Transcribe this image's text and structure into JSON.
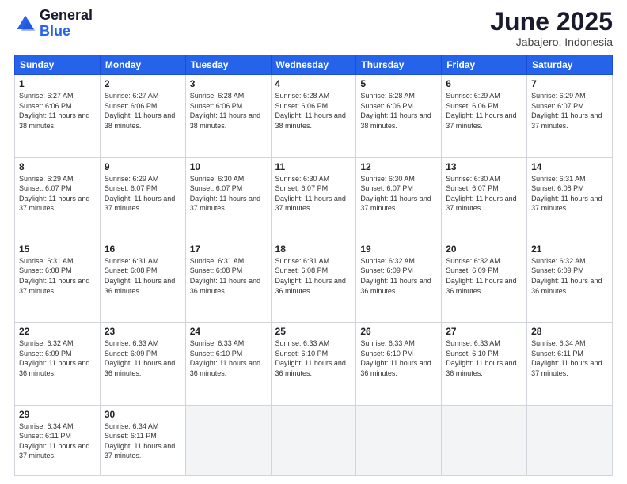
{
  "logo": {
    "general": "General",
    "blue": "Blue"
  },
  "title": "June 2025",
  "location": "Jabajero, Indonesia",
  "weekdays": [
    "Sunday",
    "Monday",
    "Tuesday",
    "Wednesday",
    "Thursday",
    "Friday",
    "Saturday"
  ],
  "weeks": [
    [
      {
        "day": 1,
        "sunrise": "6:27 AM",
        "sunset": "6:06 PM",
        "daylight": "11 hours and 38 minutes."
      },
      {
        "day": 2,
        "sunrise": "6:27 AM",
        "sunset": "6:06 PM",
        "daylight": "11 hours and 38 minutes."
      },
      {
        "day": 3,
        "sunrise": "6:28 AM",
        "sunset": "6:06 PM",
        "daylight": "11 hours and 38 minutes."
      },
      {
        "day": 4,
        "sunrise": "6:28 AM",
        "sunset": "6:06 PM",
        "daylight": "11 hours and 38 minutes."
      },
      {
        "day": 5,
        "sunrise": "6:28 AM",
        "sunset": "6:06 PM",
        "daylight": "11 hours and 38 minutes."
      },
      {
        "day": 6,
        "sunrise": "6:29 AM",
        "sunset": "6:06 PM",
        "daylight": "11 hours and 37 minutes."
      },
      {
        "day": 7,
        "sunrise": "6:29 AM",
        "sunset": "6:07 PM",
        "daylight": "11 hours and 37 minutes."
      }
    ],
    [
      {
        "day": 8,
        "sunrise": "6:29 AM",
        "sunset": "6:07 PM",
        "daylight": "11 hours and 37 minutes."
      },
      {
        "day": 9,
        "sunrise": "6:29 AM",
        "sunset": "6:07 PM",
        "daylight": "11 hours and 37 minutes."
      },
      {
        "day": 10,
        "sunrise": "6:30 AM",
        "sunset": "6:07 PM",
        "daylight": "11 hours and 37 minutes."
      },
      {
        "day": 11,
        "sunrise": "6:30 AM",
        "sunset": "6:07 PM",
        "daylight": "11 hours and 37 minutes."
      },
      {
        "day": 12,
        "sunrise": "6:30 AM",
        "sunset": "6:07 PM",
        "daylight": "11 hours and 37 minutes."
      },
      {
        "day": 13,
        "sunrise": "6:30 AM",
        "sunset": "6:07 PM",
        "daylight": "11 hours and 37 minutes."
      },
      {
        "day": 14,
        "sunrise": "6:31 AM",
        "sunset": "6:08 PM",
        "daylight": "11 hours and 37 minutes."
      }
    ],
    [
      {
        "day": 15,
        "sunrise": "6:31 AM",
        "sunset": "6:08 PM",
        "daylight": "11 hours and 37 minutes."
      },
      {
        "day": 16,
        "sunrise": "6:31 AM",
        "sunset": "6:08 PM",
        "daylight": "11 hours and 36 minutes."
      },
      {
        "day": 17,
        "sunrise": "6:31 AM",
        "sunset": "6:08 PM",
        "daylight": "11 hours and 36 minutes."
      },
      {
        "day": 18,
        "sunrise": "6:31 AM",
        "sunset": "6:08 PM",
        "daylight": "11 hours and 36 minutes."
      },
      {
        "day": 19,
        "sunrise": "6:32 AM",
        "sunset": "6:09 PM",
        "daylight": "11 hours and 36 minutes."
      },
      {
        "day": 20,
        "sunrise": "6:32 AM",
        "sunset": "6:09 PM",
        "daylight": "11 hours and 36 minutes."
      },
      {
        "day": 21,
        "sunrise": "6:32 AM",
        "sunset": "6:09 PM",
        "daylight": "11 hours and 36 minutes."
      }
    ],
    [
      {
        "day": 22,
        "sunrise": "6:32 AM",
        "sunset": "6:09 PM",
        "daylight": "11 hours and 36 minutes."
      },
      {
        "day": 23,
        "sunrise": "6:33 AM",
        "sunset": "6:09 PM",
        "daylight": "11 hours and 36 minutes."
      },
      {
        "day": 24,
        "sunrise": "6:33 AM",
        "sunset": "6:10 PM",
        "daylight": "11 hours and 36 minutes."
      },
      {
        "day": 25,
        "sunrise": "6:33 AM",
        "sunset": "6:10 PM",
        "daylight": "11 hours and 36 minutes."
      },
      {
        "day": 26,
        "sunrise": "6:33 AM",
        "sunset": "6:10 PM",
        "daylight": "11 hours and 36 minutes."
      },
      {
        "day": 27,
        "sunrise": "6:33 AM",
        "sunset": "6:10 PM",
        "daylight": "11 hours and 36 minutes."
      },
      {
        "day": 28,
        "sunrise": "6:34 AM",
        "sunset": "6:11 PM",
        "daylight": "11 hours and 37 minutes."
      }
    ],
    [
      {
        "day": 29,
        "sunrise": "6:34 AM",
        "sunset": "6:11 PM",
        "daylight": "11 hours and 37 minutes."
      },
      {
        "day": 30,
        "sunrise": "6:34 AM",
        "sunset": "6:11 PM",
        "daylight": "11 hours and 37 minutes."
      },
      null,
      null,
      null,
      null,
      null
    ]
  ]
}
